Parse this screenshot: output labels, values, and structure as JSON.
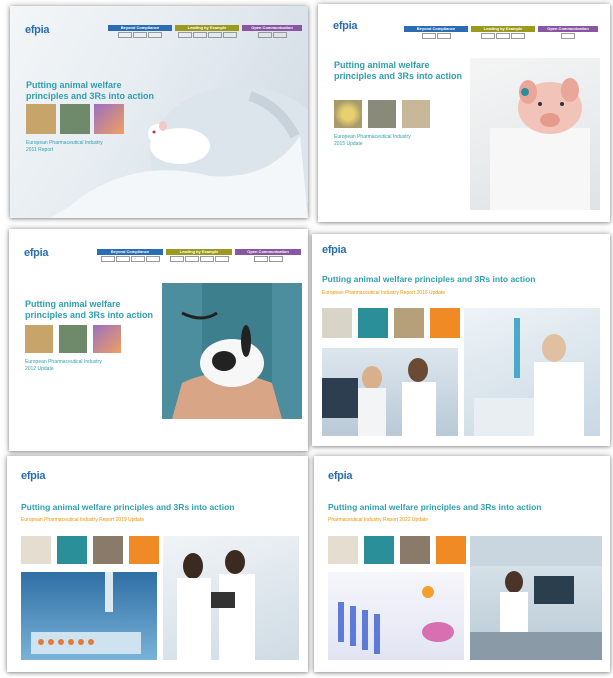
{
  "brand": {
    "logo": "efpia",
    "logo_dot": "."
  },
  "nav": {
    "col1": "Beyond Compliance",
    "col2": "Leading by Example",
    "col3": "Open Communication"
  },
  "covers": [
    {
      "title": "Putting animal welfare principles and 3Rs into action",
      "subtitle_line1": "European Pharmaceutical Industry",
      "subtitle_line2": "2011 Report"
    },
    {
      "title": "Putting animal welfare principles and 3Rs into action",
      "subtitle_line1": "European Pharmaceutical Industry",
      "subtitle_line2": "2015 Update"
    },
    {
      "title": "Putting animal welfare principles and 3Rs into action",
      "subtitle_line1": "European Pharmaceutical Industry",
      "subtitle_line2": "2012 Update"
    },
    {
      "title": "Putting animal welfare principles and 3Rs into action",
      "subtitle": "European Pharmaceutical Industry Report 2016 Update"
    },
    {
      "title": "Putting animal welfare principles and 3Rs into action",
      "subtitle": "European Pharmaceutical Industry Report 2019 Update"
    },
    {
      "title": "Putting animal welfare principles and 3Rs into action",
      "subtitle": "Pharmaceutical Industry Report 2022 Update"
    }
  ],
  "colors": {
    "teal": "#2a8f99",
    "orange": "#f08a24",
    "title": "#2f9fb0",
    "blue": "#2a6db3"
  }
}
